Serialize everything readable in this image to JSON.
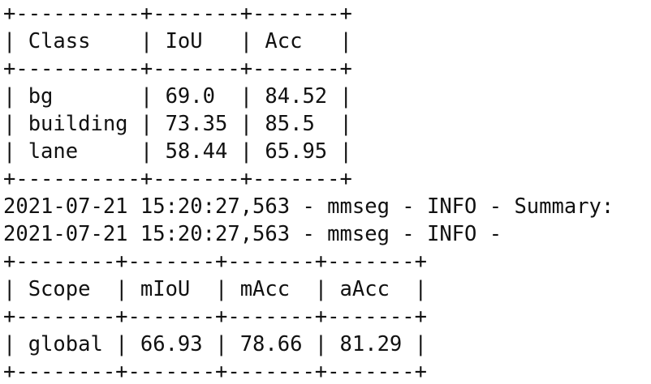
{
  "class_table": {
    "border_top": "+----------+-------+-------+",
    "header": "| Class    | IoU   | Acc   |",
    "border_mid": "+----------+-------+-------+",
    "rows": [
      "| bg       | 69.0  | 84.52 |",
      "| building | 73.35 | 85.5  |",
      "| lane     | 58.44 | 65.95 |"
    ],
    "border_bottom": "+----------+-------+-------+"
  },
  "log_lines": [
    "2021-07-21 15:20:27,563 - mmseg - INFO - Summary:",
    "2021-07-21 15:20:27,563 - mmseg - INFO -"
  ],
  "summary_table": {
    "border_top": "+--------+-------+-------+-------+",
    "header": "| Scope  | mIoU  | mAcc  | aAcc  |",
    "border_mid": "+--------+-------+-------+-------+",
    "row": "| global | 66.93 | 78.66 | 81.29 |",
    "border_bottom": "+--------+-------+-------+-------+"
  }
}
